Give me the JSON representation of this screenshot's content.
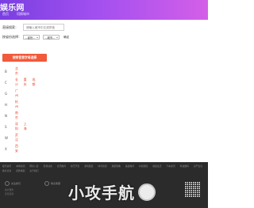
{
  "site": {
    "logo": "娱乐网"
  },
  "nav": [
    "首页",
    "切换城市"
  ],
  "form": {
    "search_label": "直接搜索：",
    "search_placeholder": "请输入城市中文或拼音",
    "province_label": "按省份选择：",
    "province_select": "--省份--",
    "city_select": "--城市--",
    "confirm": "确定"
  },
  "pinyin_button": "按拼音首字母选择",
  "letters": [
    {
      "letter": "B",
      "cities": [
        "北京"
      ]
    },
    {
      "letter": "C",
      "cities": [
        "长沙",
        "重庆",
        "成都"
      ]
    },
    {
      "letter": "G",
      "cities": [
        "广州"
      ]
    },
    {
      "letter": "H",
      "cities": [
        "杭州"
      ]
    },
    {
      "letter": "N",
      "cities": [
        "南京"
      ]
    },
    {
      "letter": "S",
      "cities": [
        "深圳",
        "上海"
      ]
    },
    {
      "letter": "W",
      "cities": [
        "武汉"
      ]
    },
    {
      "letter": "X",
      "cities": [
        "西安"
      ]
    }
  ],
  "footer": {
    "links": [
      "娱乐资讯",
      "本地新闻",
      "明星八卦",
      "影视动态",
      "音乐推荐",
      "综艺节目",
      "游戏频道",
      "体育新闻",
      "旅游攻略",
      "美食推荐",
      "时尚潮流",
      "健康生活",
      "汽车资讯",
      "科技数码",
      "房产信息",
      "教育培训",
      "招聘求职",
      "关于我们"
    ],
    "contact_1": "关注我们",
    "contact_2": "联系客服",
    "sub_1": "客户服务",
    "sub_2": "意见反馈",
    "watermark": "小攻手航"
  },
  "colors": {
    "header_start": "#7a3fe0",
    "header_end": "#d45fe8",
    "accent": "#f15a3b",
    "city": "#e8442a",
    "footer": "#2b2b2b"
  }
}
